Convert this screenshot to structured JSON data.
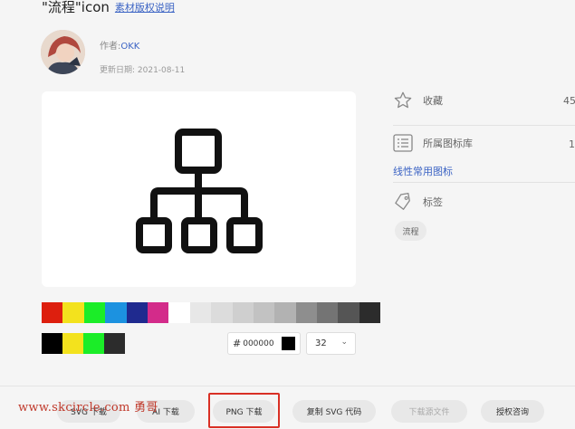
{
  "header": {
    "title": "\"流程\"icon",
    "license_link": "素材版权说明"
  },
  "author": {
    "label": "作者:",
    "name": "OKK",
    "updated": "更新日期: 2021-08-11"
  },
  "colors": {
    "palette_row1": [
      "#dd1f0e",
      "#f3e21d",
      "#1bed28",
      "#1c92e0",
      "#1f2a8f",
      "#d32b8a",
      "#ffffff",
      "#e7e7e7",
      "#dcdcdc",
      "#cfcfcf",
      "#c2c2c2",
      "#b2b2b2",
      "#8e8e8e",
      "#747474",
      "#555555",
      "#2c2c2c"
    ],
    "palette_row2": [
      "#000000",
      "#f3e21d",
      "#1bed28",
      "#2c2c2c"
    ],
    "link": "#3b63c4",
    "highlight": "#d93025"
  },
  "controls": {
    "hex_value": "000000",
    "size_value": "32"
  },
  "sidebar": {
    "favorite_label": "收藏",
    "favorite_count": "45",
    "library_label": "所属图标库",
    "library_count": "1",
    "library_link": "线性常用图标",
    "tags_label": "标签",
    "tag": "流程"
  },
  "footer": {
    "svg_download": "SVG 下载",
    "ai_download": "AI 下载",
    "png_download": "PNG 下载",
    "copy_svg": "复制 SVG 代码",
    "source_download": "下载源文件",
    "license_consult": "授权咨询"
  },
  "watermark": "www.skcircle.com 勇哥"
}
